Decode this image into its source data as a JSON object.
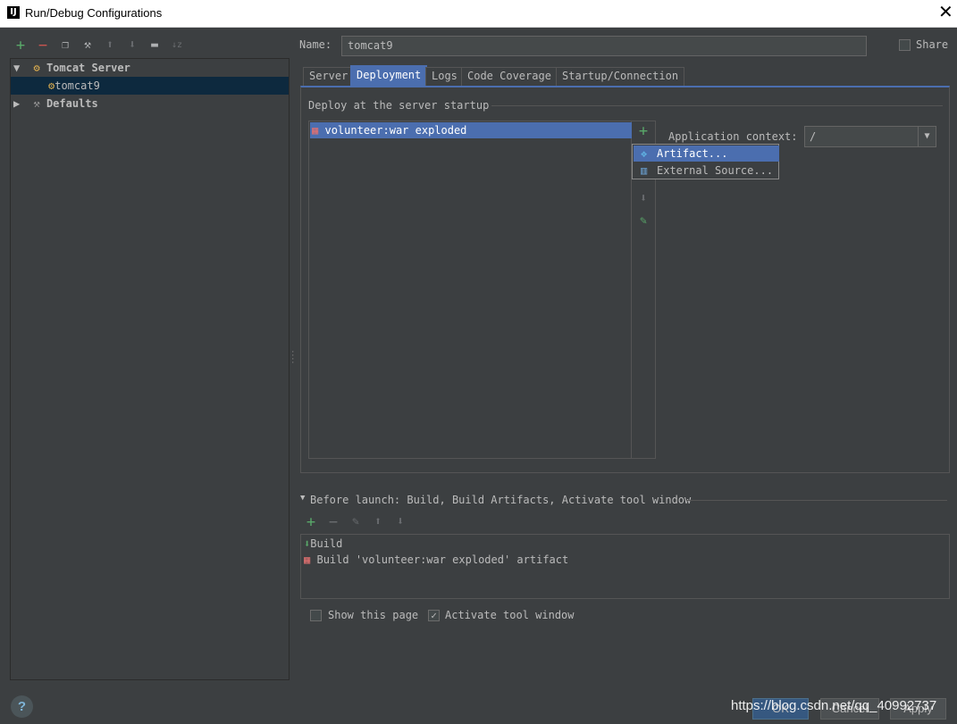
{
  "window": {
    "title": "Run/Debug Configurations",
    "app_icon": "IJ",
    "close_label": "✕"
  },
  "left_toolbar": {
    "icons": [
      "add-icon",
      "remove-icon",
      "copy-icon",
      "edit-defaults-icon",
      "move-up-icon",
      "move-down-icon",
      "folder-icon",
      "sort-icon"
    ]
  },
  "tree": {
    "groups": [
      {
        "label": "Tomcat Server",
        "expanded": true,
        "children": [
          {
            "label": "tomcat9"
          }
        ]
      },
      {
        "label": "Defaults",
        "expanded": false
      }
    ]
  },
  "form": {
    "name_label": "Name:",
    "name_value": "tomcat9",
    "share_label": "Share",
    "share_checked": false
  },
  "tabs": [
    "Server",
    "Deployment",
    "Logs",
    "Code Coverage",
    "Startup/Connection"
  ],
  "active_tab": "Deployment",
  "deployment": {
    "section_title": "Deploy at the server startup",
    "items": [
      "volunteer:war exploded"
    ],
    "app_context_label": "Application context:",
    "app_context_value": "/"
  },
  "add_popup": {
    "items": [
      "Artifact...",
      "External Source..."
    ],
    "selected": "Artifact..."
  },
  "before_launch": {
    "title": "Before launch: Build, Build Artifacts, Activate tool window",
    "items": [
      "Build",
      "Build 'volunteer:war exploded' artifact"
    ]
  },
  "options": {
    "show_page_label": "Show this page",
    "show_page_checked": false,
    "activate_tool_label": "Activate tool window",
    "activate_tool_checked": true
  },
  "footer": {
    "help": "?",
    "ok_label": "OK",
    "cancel_label": "Cancel",
    "apply_label": "Apply",
    "watermark": "https://blog.csdn.net/qq_40992737"
  },
  "colors": {
    "background": "#3c3f41",
    "selection": "#4b6eaf",
    "tree_selection": "#0d293e",
    "add_green": "#59a869",
    "remove_red": "#c75450"
  }
}
